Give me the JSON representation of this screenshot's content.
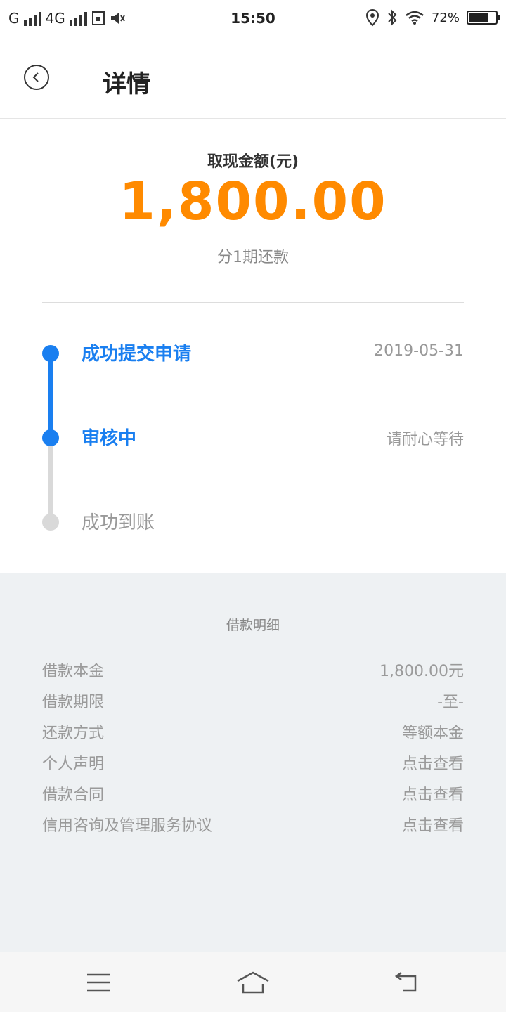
{
  "status_bar": {
    "network1": "G",
    "network2": "4G",
    "time": "15:50",
    "battery_percent": "72%",
    "battery_level": 0.72
  },
  "header": {
    "title": "详情",
    "back_icon": "back-chevron-icon"
  },
  "summary": {
    "amount_label": "取现金额(元)",
    "amount": "1,800.00",
    "installment": "分1期还款",
    "accent_color": "#ff8a00"
  },
  "timeline": {
    "steps": [
      {
        "label": "成功提交申请",
        "right": "2019-05-31",
        "state": "done"
      },
      {
        "label": "审核中",
        "right": "请耐心等待",
        "state": "current"
      },
      {
        "label": "成功到账",
        "right": "",
        "state": "pending"
      }
    ],
    "active_color": "#1a7ff0",
    "inactive_color": "#d9d9d9"
  },
  "details": {
    "title": "借款明细",
    "rows": [
      {
        "label": "借款本金",
        "value": "1,800.00元"
      },
      {
        "label": "借款期限",
        "value": "-至-"
      },
      {
        "label": "还款方式",
        "value": "等额本金"
      },
      {
        "label": "个人声明",
        "value": "点击查看"
      },
      {
        "label": "借款合同",
        "value": "点击查看"
      },
      {
        "label": "信用咨询及管理服务协议",
        "value": "点击查看"
      }
    ]
  },
  "nav": {
    "menu_icon": "menu-icon",
    "home_icon": "home-icon",
    "back_icon": "back-icon"
  }
}
